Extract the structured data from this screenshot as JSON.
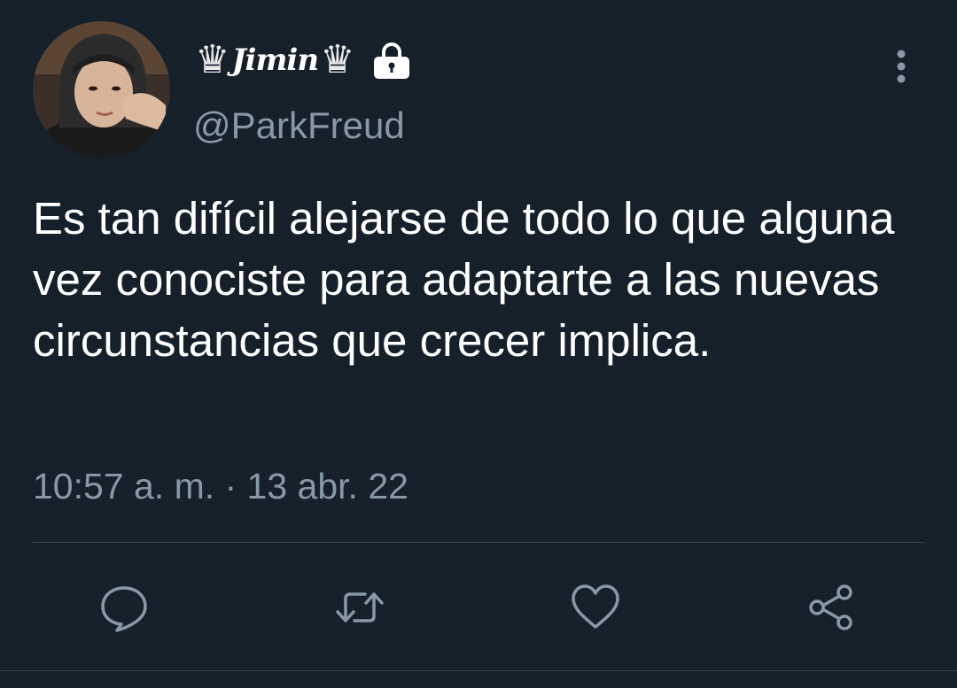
{
  "user": {
    "display_name": "Jimin",
    "name_prefix_glyph": "♛",
    "name_suffix_glyph": "♛",
    "handle": "@ParkFreud",
    "protected_icon": "lock-icon",
    "avatar_icon": "avatar-photo"
  },
  "tweet": {
    "text": "Es tan difícil alejarse de todo lo que alguna vez conociste para adaptarte a las nuevas circunstancias que crecer implica.",
    "timestamp": "10:57 a. m. · 13 abr. 22"
  },
  "actions": {
    "reply_icon": "reply-icon",
    "retweet_icon": "retweet-icon",
    "like_icon": "heart-icon",
    "share_icon": "share-icon",
    "more_icon": "more-vertical-icon"
  },
  "colors": {
    "background": "#15202b",
    "text_primary": "#ffffff",
    "text_secondary": "#8899a6",
    "divider": "#38444d"
  }
}
